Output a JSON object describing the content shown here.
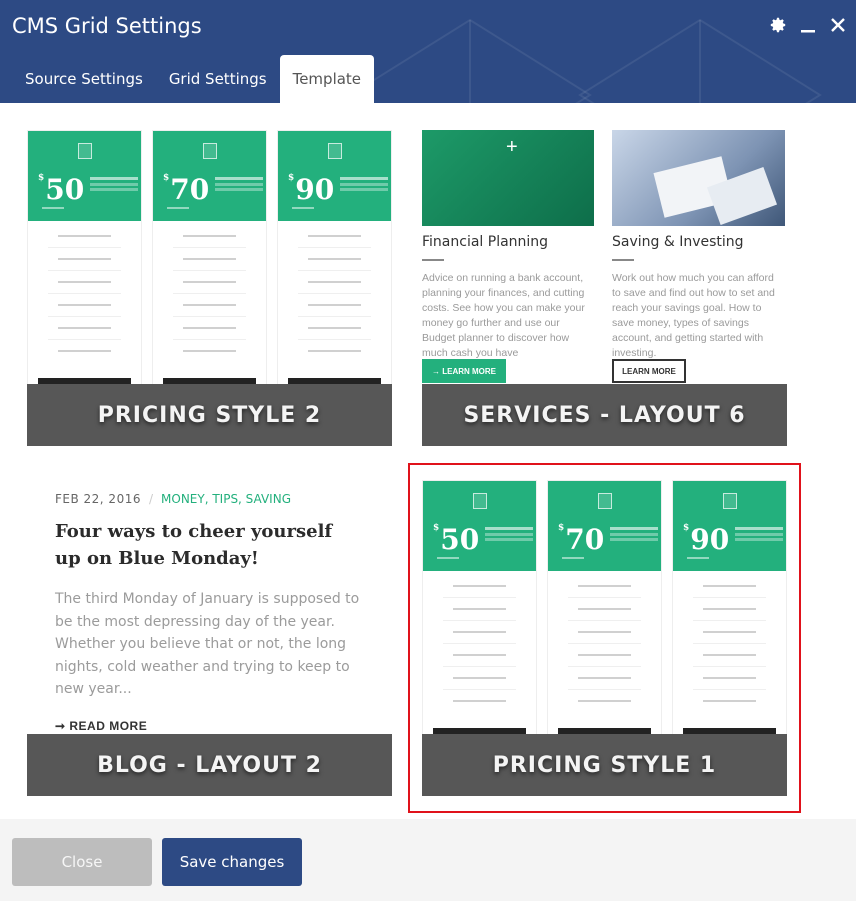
{
  "window": {
    "title": "CMS Grid Settings",
    "icons": [
      "gear-icon",
      "minimize-icon",
      "close-icon"
    ]
  },
  "tabs": [
    {
      "label": "Source Settings",
      "active": false
    },
    {
      "label": "Grid Settings",
      "active": false
    },
    {
      "label": "Template",
      "active": true
    }
  ],
  "templates": [
    {
      "label": "PRICING STYLE 2",
      "selected": false
    },
    {
      "label": "SERVICES - LAYOUT 6",
      "selected": false
    },
    {
      "label": "BLOG - LAYOUT 2",
      "selected": false
    },
    {
      "label": "PRICING STYLE 1",
      "selected": true
    }
  ],
  "pricing_preview": {
    "currency": "$",
    "prices": [
      "50",
      "70",
      "90"
    ]
  },
  "services_preview": {
    "items": [
      {
        "title": "Financial Planning",
        "text": "Advice on running a bank account, planning your finances, and cutting costs. See how you can make your money go further and use our Budget planner to discover how much cash you have",
        "button": "→ LEARN MORE"
      },
      {
        "title": "Saving & Investing",
        "text": "Work out how much you can afford to save and find out how to set and reach your savings goal. How to save money, types of savings account, and getting started with investing.",
        "button": "LEARN MORE"
      }
    ]
  },
  "blog_preview": {
    "date": "FEB 22, 2016",
    "separator": "/",
    "categories": "MONEY, TIPS, SAVING",
    "title": "Four ways to cheer yourself up on Blue Monday!",
    "excerpt": "The third Monday of January is supposed to be the most depressing day of the year. Whether you believe that or not, the long nights, cold weather and trying to keep to new year...",
    "read_more": "➞ READ MORE"
  },
  "footer": {
    "close_label": "Close",
    "save_label": "Save changes"
  },
  "colors": {
    "header": "#2d4a84",
    "accent_green": "#23b07d",
    "selected_border": "#e0121b",
    "label_band": "#575757"
  }
}
